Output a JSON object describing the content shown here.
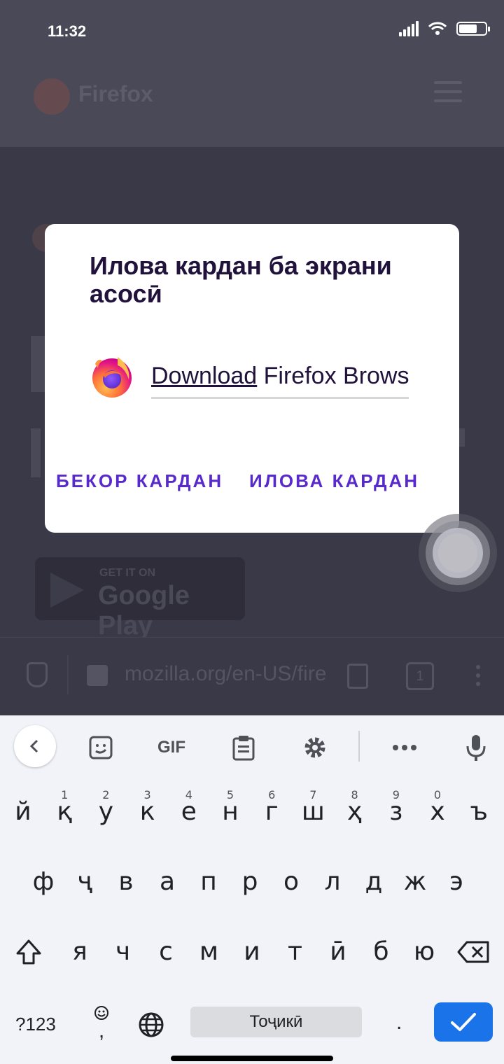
{
  "status_bar": {
    "time": "11:32",
    "battery_level": 0.7
  },
  "site": {
    "name": "Firefox",
    "url": "mozilla.org/en-US/fire",
    "tab_count": "1",
    "store_badge_small": "GET IT ON",
    "store_badge_big": "Google Play"
  },
  "dialog": {
    "title": "Илова кардан ба экрани асосӣ",
    "input_value_underlined": "Download",
    "input_value_rest": " Firefox Browser",
    "cancel_label": "БЕКОР КАРДАН",
    "add_label": "ИЛОВА КАРДАН"
  },
  "keyboard": {
    "toolbar": {
      "gif_label": "GIF"
    },
    "row1": [
      {
        "k": "й",
        "n": ""
      },
      {
        "k": "қ",
        "n": "1"
      },
      {
        "k": "у",
        "n": "2"
      },
      {
        "k": "к",
        "n": "3"
      },
      {
        "k": "е",
        "n": "4"
      },
      {
        "k": "н",
        "n": "5"
      },
      {
        "k": "г",
        "n": "6"
      },
      {
        "k": "ш",
        "n": "7"
      },
      {
        "k": "ҳ",
        "n": "8"
      },
      {
        "k": "з",
        "n": "9"
      },
      {
        "k": "х",
        "n": "0"
      },
      {
        "k": "ъ",
        "n": ""
      }
    ],
    "row2": [
      "ф",
      "ҷ",
      "в",
      "а",
      "п",
      "р",
      "о",
      "л",
      "д",
      "ж",
      "э"
    ],
    "row3": [
      "я",
      "ч",
      "с",
      "м",
      "и",
      "т",
      "ӣ",
      "б",
      "ю"
    ],
    "symbols_label": "?123",
    "emoji_comma_label": ",",
    "space_label": "Тоҷикӣ",
    "period_label": ".",
    "accent_color": "#1a73e8"
  }
}
